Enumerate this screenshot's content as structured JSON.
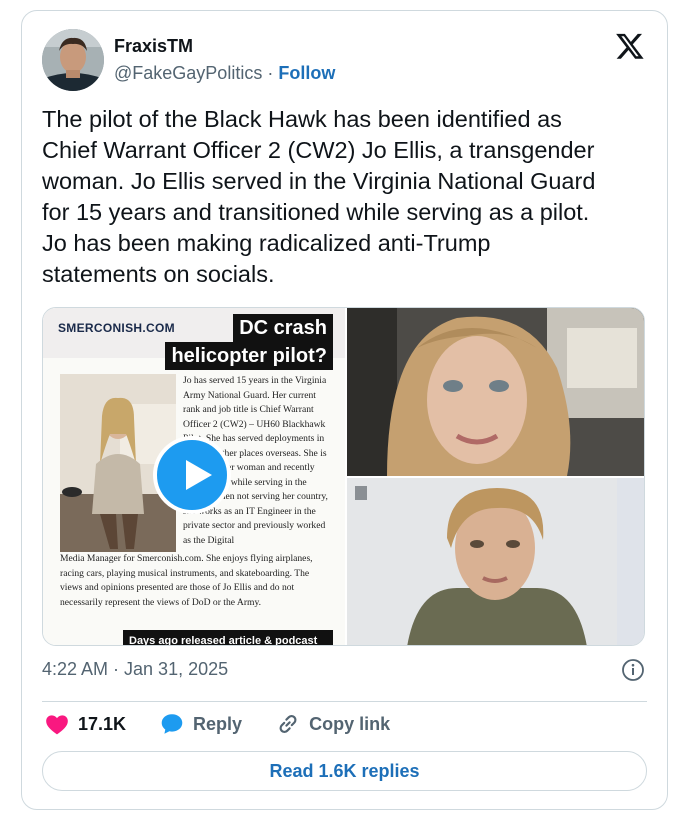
{
  "author": {
    "name": "FraxisTM",
    "handle": "@FakeGayPolitics",
    "separator": "·",
    "follow_label": "Follow"
  },
  "tweet": {
    "text": "The pilot of the Black Hawk has been identified as\nChief Warrant Officer 2 (CW2) Jo Ellis, a transgender\nwoman. Jo Ellis served in the Virginia National Guard\nfor 15 years and transitioned while serving as a pilot.\nJo has been making radicalized anti-Trump\nstatements on socials."
  },
  "media": {
    "site_logo": "SMERCONISH.COM",
    "overlay_line1": "DC crash",
    "overlay_line2": "helicopter pilot?",
    "article_narrow": "Jo has served 15 years in the Virginia Army National Guard. Her current rank and job title is Chief Warrant Officer 2 (CW2) – UH60 Blackhawk Pilot. She has served deployments in Iraq and other places overseas. She is a transgender woman and recently transitioned while serving in the Guard. When not serving her country, she works as an IT Engineer in the private sector and previously worked as the Digital",
    "article_wide": "Media Manager for Smerconish.com. She enjoys flying airplanes, racing cars, playing musical instruments, and skateboarding. The views and opinions presented are those of Jo Ellis and do not necessarily represent the views of DoD or the Army.",
    "caption_strip": "Days ago released article & podcast"
  },
  "meta": {
    "timestamp": "4:22 AM · Jan 31, 2025"
  },
  "actions": {
    "likes": "17.1K",
    "reply_label": "Reply",
    "copy_label": "Copy link",
    "read_replies_label": "Read 1.6K replies"
  },
  "colors": {
    "like": "#f91880",
    "accent": "#1d9bf0",
    "link": "#1d6fb8",
    "muted": "#536471",
    "border": "#cfd9de"
  }
}
